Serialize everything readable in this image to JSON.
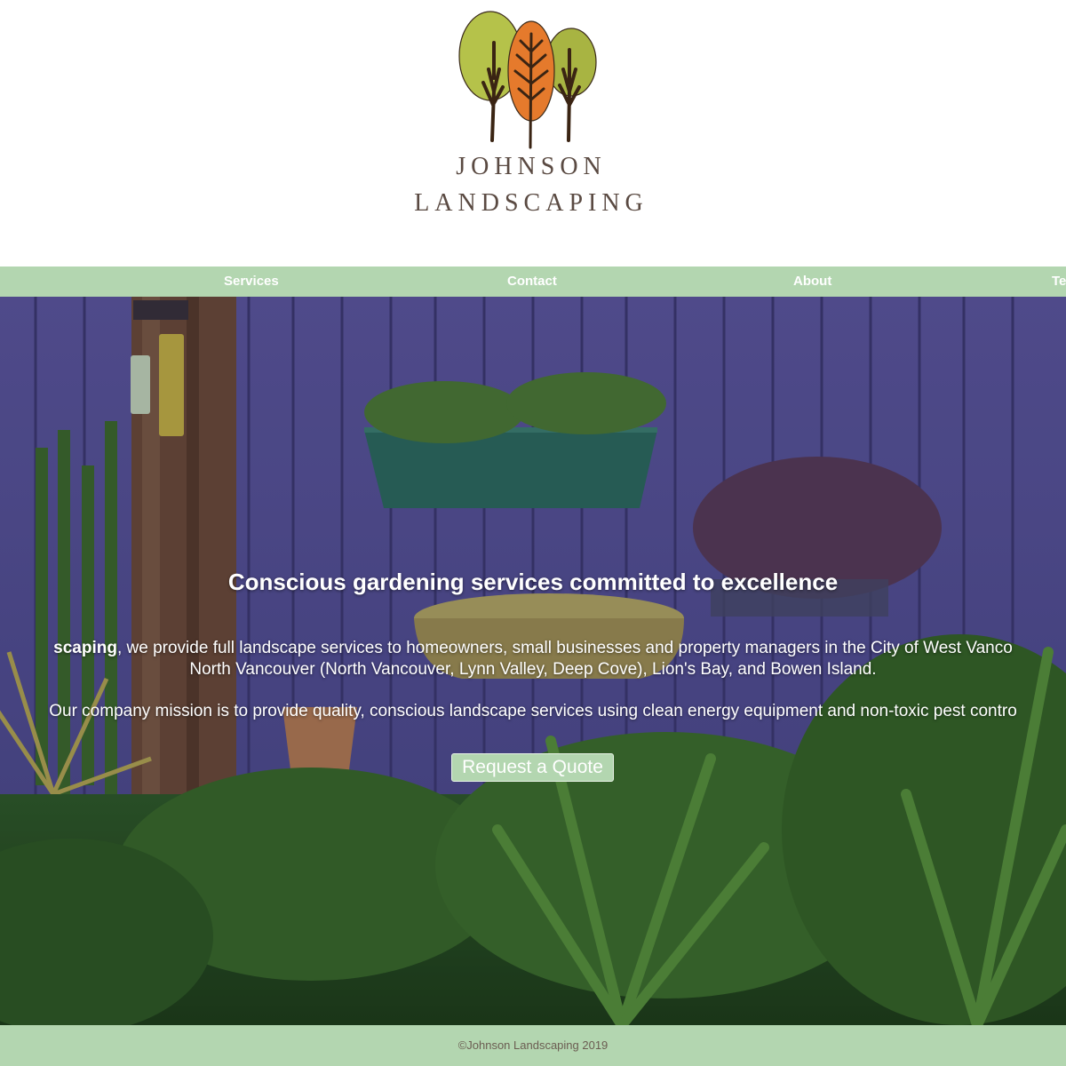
{
  "brand": {
    "name_line1": "JOHNSON",
    "name_line2": "LANDSCAPING"
  },
  "nav": {
    "items": [
      {
        "label": "Services"
      },
      {
        "label": "Contact"
      },
      {
        "label": "About"
      },
      {
        "label": "Te"
      }
    ]
  },
  "hero": {
    "heading": "Conscious gardening services committed to excellence",
    "intro_bold": "scaping",
    "intro_line1_rest": ", we provide full landscape services to homeowners, small businesses and property managers in the City of West Vanco",
    "intro_line2": "North Vancouver (North Vancouver, Lynn Valley, Deep Cove), Lion's Bay, and Bowen Island.",
    "mission": "Our company mission is to provide quality, conscious landscape services using clean energy equipment and non-toxic pest contro",
    "cta_label": "Request a Quote"
  },
  "footer": {
    "copyright": "©Johnson Landscaping 2019"
  },
  "colors": {
    "nav_background": "#b3d6b0",
    "brand_text": "#5a4a42",
    "tree_left": "#b5c24a",
    "tree_center": "#e57a2c",
    "tree_right": "#a8b442"
  }
}
